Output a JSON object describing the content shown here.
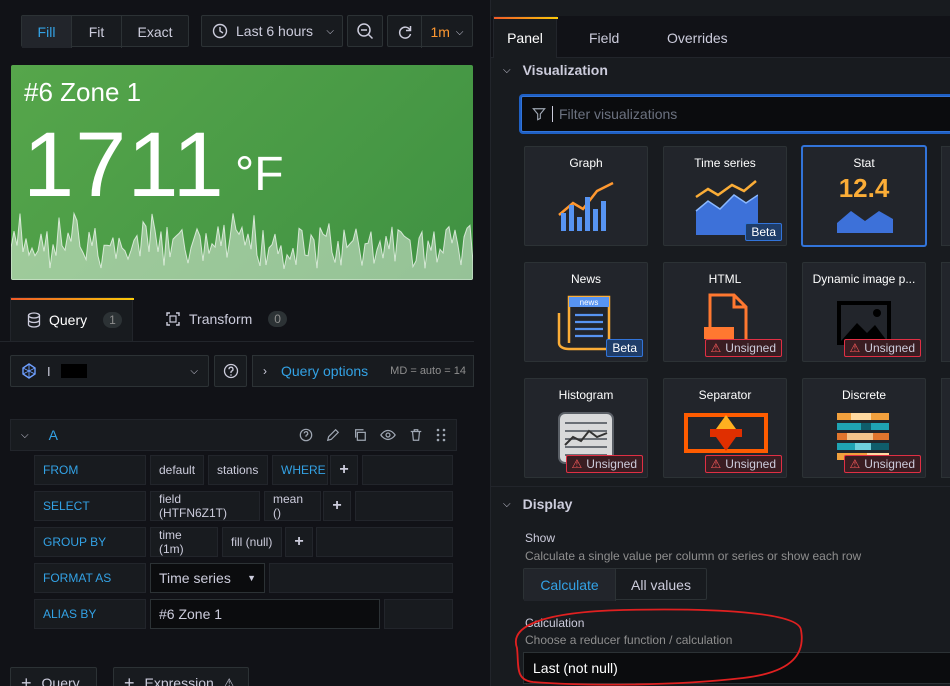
{
  "toolbar": {
    "fill": "Fill",
    "fit": "Fit",
    "exact": "Exact",
    "time_range": "Last 6 hours",
    "refresh_interval": "1m"
  },
  "stat": {
    "title": "#6 Zone 1",
    "value": "1711",
    "unit": "°F"
  },
  "query_tabs": {
    "query_label": "Query",
    "query_count": "1",
    "transform_label": "Transform",
    "transform_count": "0"
  },
  "datasource": {
    "name": "I",
    "query_options": "Query options",
    "md_info": "MD = auto = 14"
  },
  "query": {
    "ref_id": "A",
    "from_label": "FROM",
    "from_policy": "default",
    "from_measurement": "stations",
    "where_label": "WHERE",
    "select_label": "SELECT",
    "select_field": "field (HTFN6Z1T)",
    "select_agg": "mean ()",
    "group_label": "GROUP BY",
    "group_time": "time (1m)",
    "group_fill": "fill (null)",
    "format_label": "FORMAT AS",
    "format_value": "Time series",
    "alias_label": "ALIAS BY",
    "alias_value": "#6 Zone 1"
  },
  "bottom_buttons": {
    "add_query": "Query",
    "add_expression": "Expression"
  },
  "right_tabs": {
    "panel": "Panel",
    "field": "Field",
    "overrides": "Overrides"
  },
  "visualization": {
    "section_title": "Visualization",
    "filter_placeholder": "Filter visualizations",
    "cards": [
      {
        "title": "Graph",
        "badge": ""
      },
      {
        "title": "Time series",
        "badge": "Beta"
      },
      {
        "title": "Stat",
        "badge": "",
        "stat_sample": "12.4"
      },
      {
        "title": "News",
        "badge": "Beta",
        "news_word": "news"
      },
      {
        "title": "HTML",
        "badge": "Unsigned"
      },
      {
        "title": "Dynamic image p...",
        "badge": "Unsigned"
      },
      {
        "title": "Histogram",
        "badge": "Unsigned"
      },
      {
        "title": "Separator",
        "badge": "Unsigned"
      },
      {
        "title": "Discrete",
        "badge": "Unsigned"
      }
    ]
  },
  "display": {
    "section_title": "Display",
    "show_label": "Show",
    "show_desc": "Calculate a single value per column or series or show each row",
    "calculate": "Calculate",
    "all_values": "All values",
    "calc_label": "Calculation",
    "calc_desc": "Choose a reducer function / calculation",
    "calc_value": "Last (not null)"
  },
  "colors": {
    "stat_green": "#56a64b",
    "accent_blue": "#33a2e5",
    "annotation_red": "#e02020"
  }
}
